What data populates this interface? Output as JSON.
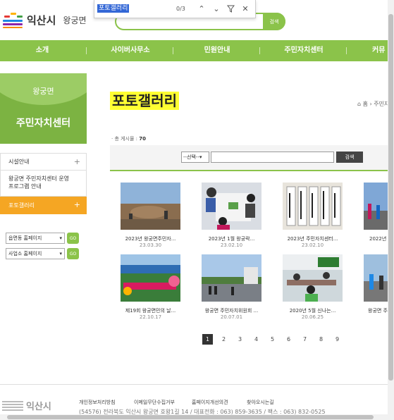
{
  "header": {
    "site_name": "익산시",
    "district": "왕궁면",
    "search_button": "검색"
  },
  "find_bar": {
    "query": "포토갤러리",
    "count": "0/3",
    "up_icon": "chevron-up-icon",
    "down_icon": "chevron-down-icon",
    "filter_icon": "filter-icon",
    "close_icon": "close-icon"
  },
  "nav": {
    "items": [
      "소개",
      "사이버사무소",
      "민원안내",
      "주민자치센터",
      "커뮤"
    ]
  },
  "sidebar": {
    "subtitle": "왕궁면",
    "title": "주민자치센터",
    "items": [
      {
        "label": "시설안내",
        "expand": "+"
      },
      {
        "label": "왕궁면 주민자치센터 운영 프로그램 안내",
        "expand": ""
      },
      {
        "label": "포토갤러리",
        "expand": "+"
      }
    ],
    "select1": "읍면동 홈페이지",
    "select2": "사업소 홈페이지",
    "go_label": "GO"
  },
  "content": {
    "title": "포토갤러리",
    "breadcrumb_home": "홈",
    "breadcrumb_next": "주민자",
    "total_label": "· 총 게시물 :",
    "total_count": "70",
    "search_select": "--선택--",
    "search_button": "검색"
  },
  "gallery": [
    {
      "title": "2023년 왕궁면주민자...",
      "date": "23.03.30"
    },
    {
      "title": "2023년 1월 왕궁락...",
      "date": "23.02.10"
    },
    {
      "title": "2023년 주민자치센터...",
      "date": "23.02.10"
    },
    {
      "title": "2022년",
      "date": ""
    },
    {
      "title": "제19회 왕궁면민의 날...",
      "date": "22.10.17"
    },
    {
      "title": "왕궁면 주민자치위원회 ...",
      "date": "20.07.01"
    },
    {
      "title": "2020년 5월 신나는...",
      "date": "20.06.25"
    },
    {
      "title": "왕궁면 주",
      "date": ""
    }
  ],
  "pagination": [
    "1",
    "2",
    "3",
    "4",
    "5",
    "6",
    "7",
    "8",
    "9"
  ],
  "footer": {
    "logo": "익산시",
    "links": [
      "개인정보처리방침",
      "이메일무단수집거부",
      "홈페이지개선의견",
      "찾아오시는길"
    ],
    "address": "(54576) 전라북도 익산시 왕궁면 호왕1길 14 / 대표전화 : 063) 859-3635 / 팩스 : 063) 832-0525"
  },
  "colors": {
    "accent_green": "#8bc34a",
    "side_green": "#7cb342",
    "active_orange": "#f5a623",
    "highlight_yellow": "#ffff33"
  }
}
